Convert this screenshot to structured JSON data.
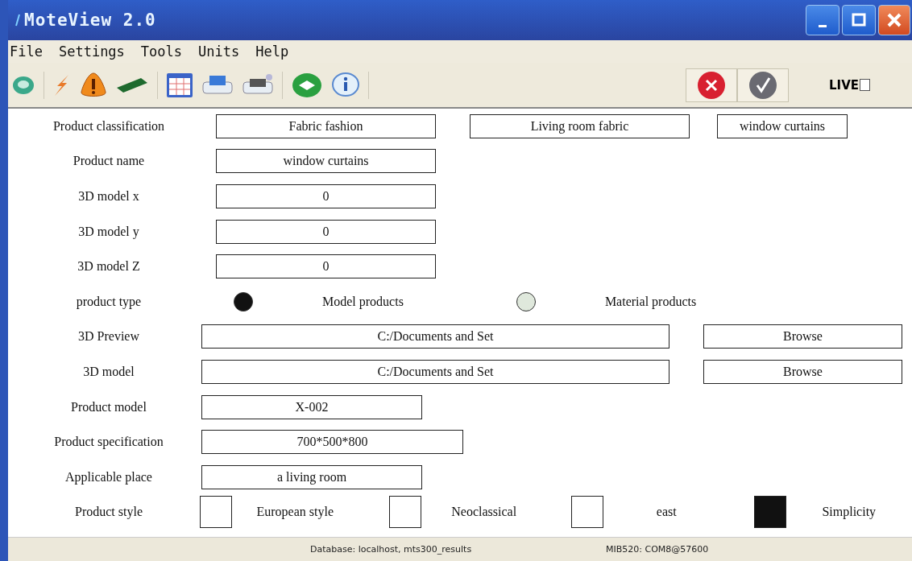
{
  "window": {
    "title": "MoteView 2.0"
  },
  "menu": [
    "File",
    "Settings",
    "Tools",
    "Units",
    "Help"
  ],
  "live": {
    "label": "LIVE",
    "checked": false
  },
  "form": [
    {
      "kind": "fields",
      "label": "Product classification",
      "values": [
        "Fabric fashion",
        "Living room fabric",
        "window curtains"
      ]
    },
    {
      "kind": "fields",
      "label": "Product name",
      "values": [
        "window curtains"
      ]
    },
    {
      "kind": "fields",
      "label": "3D model x",
      "values": [
        "0"
      ]
    },
    {
      "kind": "fields",
      "label": "3D model y",
      "values": [
        "0"
      ]
    },
    {
      "kind": "fields",
      "label": "3D model Z",
      "values": [
        "0"
      ]
    },
    {
      "kind": "radio",
      "label": "product type",
      "options": [
        {
          "label": "Model products",
          "selected": true
        },
        {
          "label": "Material products",
          "selected": false
        }
      ]
    },
    {
      "kind": "path",
      "label": "3D Preview",
      "value": "C:/Documents and Set",
      "button": "Browse"
    },
    {
      "kind": "path",
      "label": "3D model",
      "value": "C:/Documents and Set",
      "button": "Browse"
    },
    {
      "kind": "fields",
      "label": "Product model",
      "values": [
        "X-002"
      ]
    },
    {
      "kind": "fields",
      "label": "Product specification",
      "values": [
        "700*500*800"
      ]
    },
    {
      "kind": "fields",
      "label": "Applicable place",
      "values": [
        "a living room"
      ]
    },
    {
      "kind": "checks",
      "label": "Product style",
      "options": [
        {
          "label": "European style",
          "checked": false
        },
        {
          "label": "Neoclassical",
          "checked": false
        },
        {
          "label": "east",
          "checked": false
        },
        {
          "label": "Simplicity",
          "checked": true
        }
      ]
    }
  ],
  "status_bar": [
    "Database: localhost, mts300_results",
    "MIB520: COM8@57600"
  ]
}
